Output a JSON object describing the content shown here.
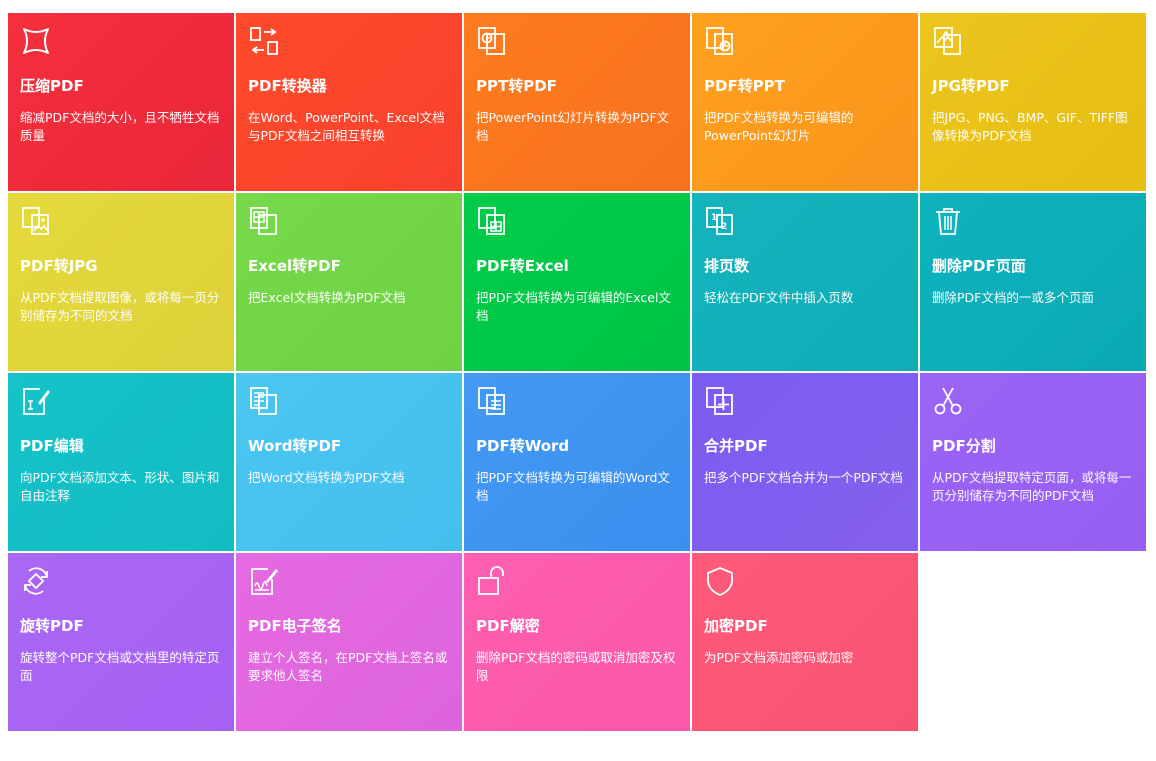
{
  "tools": [
    {
      "title": "压缩PDF",
      "desc": "缩减PDF文档的大小，且不牺牲文档质量",
      "icon": "compress-icon",
      "color": "#f5303c",
      "color2": "#e9263a"
    },
    {
      "title": "PDF转换器",
      "desc": "在Word、PowerPoint、Excel文档与PDF文档之间相互转换",
      "icon": "convert-icon",
      "color": "#ff4b2b",
      "color2": "#f8402d"
    },
    {
      "title": "PPT转PDF",
      "desc": "把PowerPoint幻灯片转换为PDF文档",
      "icon": "ppt-to-pdf-icon",
      "color": "#ff7b1e",
      "color2": "#f7721f"
    },
    {
      "title": "PDF转PPT",
      "desc": "把PDF文档转换为可编辑的PowerPoint幻灯片",
      "icon": "pdf-to-ppt-icon",
      "color": "#ffa01e",
      "color2": "#f9951c"
    },
    {
      "title": "JPG转PDF",
      "desc": "把JPG、PNG、BMP、GIF、TIFF图像转换为PDF文档",
      "icon": "jpg-to-pdf-icon",
      "color": "#ecc51d",
      "color2": "#e6bd12"
    },
    {
      "title": "PDF转JPG",
      "desc": "从PDF文档提取图像，或将每一页分别储存为不同的文档",
      "icon": "pdf-to-jpg-icon",
      "color": "#e5d93a",
      "color2": "#dcd23a"
    },
    {
      "title": "Excel转PDF",
      "desc": "把Excel文档转换为PDF文档",
      "icon": "excel-to-pdf-icon",
      "color": "#76d94a",
      "color2": "#6ed244"
    },
    {
      "title": "PDF转Excel",
      "desc": "把PDF文档转换为可编辑的Excel文档",
      "icon": "pdf-to-excel-icon",
      "color": "#00cc49",
      "color2": "#00c446"
    },
    {
      "title": "排页数",
      "desc": "轻松在PDF文件中插入页数",
      "icon": "page-number-icon",
      "color": "#14b4bd",
      "color2": "#10adb8"
    },
    {
      "title": "删除PDF页面",
      "desc": "删除PDF文档的一或多个页面",
      "icon": "trash-icon",
      "color": "#0eb3bd",
      "color2": "#0aaab5"
    },
    {
      "title": "PDF编辑",
      "desc": "向PDF文档添加文本、形状、图片和自由注释",
      "icon": "edit-icon",
      "color": "#15c3c9",
      "color2": "#12bcc3"
    },
    {
      "title": "Word转PDF",
      "desc": "把Word文档转换为PDF文档",
      "icon": "word-to-pdf-icon",
      "color": "#4bc6f1",
      "color2": "#44bfed"
    },
    {
      "title": "PDF转Word",
      "desc": "把PDF文档转换为可编辑的Word文档",
      "icon": "pdf-to-word-icon",
      "color": "#4299f3",
      "color2": "#3b8fef"
    },
    {
      "title": "合并PDF",
      "desc": "把多个PDF文档合并为一个PDF文档",
      "icon": "merge-icon",
      "color": "#7a5cf0",
      "color2": "#8660ee"
    },
    {
      "title": "PDF分割",
      "desc": "从PDF文档提取特定页面，或将每一页分别储存为不同的PDF文档",
      "icon": "scissors-icon",
      "color": "#9c64f5",
      "color2": "#965ef2"
    },
    {
      "title": "旋转PDF",
      "desc": "旋转整个PDF文档或文档里的特定页面",
      "icon": "rotate-icon",
      "color": "#aa67f5",
      "color2": "#a561f3"
    },
    {
      "title": "PDF电子签名",
      "desc": "建立个人签名，在PDF文档上签名或要求他人签名",
      "icon": "signature-icon",
      "color": "#e56ae1",
      "color2": "#de64dc"
    },
    {
      "title": "PDF解密",
      "desc": "删除PDF文档的密码或取消加密及权限",
      "icon": "unlock-icon",
      "color": "#ff5fb0",
      "color2": "#fa58a8"
    },
    {
      "title": "加密PDF",
      "desc": "为PDF文档添加密码或加密",
      "icon": "shield-icon",
      "color": "#ff5a7a",
      "color2": "#f95272"
    }
  ]
}
